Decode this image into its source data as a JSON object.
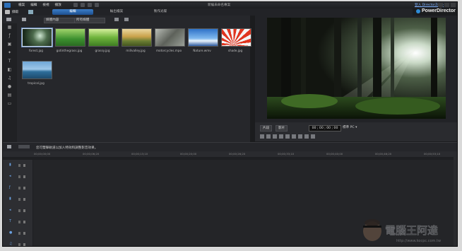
{
  "menu": [
    "檔案",
    "編輯",
    "檢視",
    "播放"
  ],
  "project_title": "新編未命名專案",
  "account_link": "登入 DirectorZone",
  "brand": "PowerDirector",
  "modebar": {
    "import_label": "擷取",
    "tabs": [
      "編輯",
      "輸出檔案",
      "製作光碟"
    ],
    "active_tab": "編輯"
  },
  "library": {
    "filter_dropdown": "媒體內容",
    "sort_dropdown": "所有媒體",
    "items": [
      {
        "caption": "forest.jpg",
        "selected": true
      },
      {
        "caption": "gotinthegrass.jpg",
        "selected": false
      },
      {
        "caption": "grassy.jpg",
        "selected": false
      },
      {
        "caption": "millvalley.jpg",
        "selected": false
      },
      {
        "caption": "motorcycles.mpo",
        "selected": false
      },
      {
        "caption": "Nature.wmv",
        "selected": false
      },
      {
        "caption": "shade.jpg",
        "selected": false
      },
      {
        "caption": "tropical.jpg",
        "selected": false
      }
    ]
  },
  "preview": {
    "clip_button": "片段",
    "movie_button": "影片",
    "timecode": "00 ; 00 ; 00 ; 00",
    "quality": "標準 PC ▾"
  },
  "timeline": {
    "hint": "您可雙擊軌道以加入特效和調整影音效果。",
    "ruler_ticks": [
      "00;00;00;00",
      "00;00;06;20",
      "00;00;13;10",
      "00;00;20;00",
      "00;00;26;20",
      "00;00;33;10",
      "00;00;40;00",
      "00;00;46;20",
      "00;00;53;10"
    ]
  },
  "watermark": {
    "text": "電腦王阿達",
    "url": "http://www.kocpc.com.tw"
  }
}
